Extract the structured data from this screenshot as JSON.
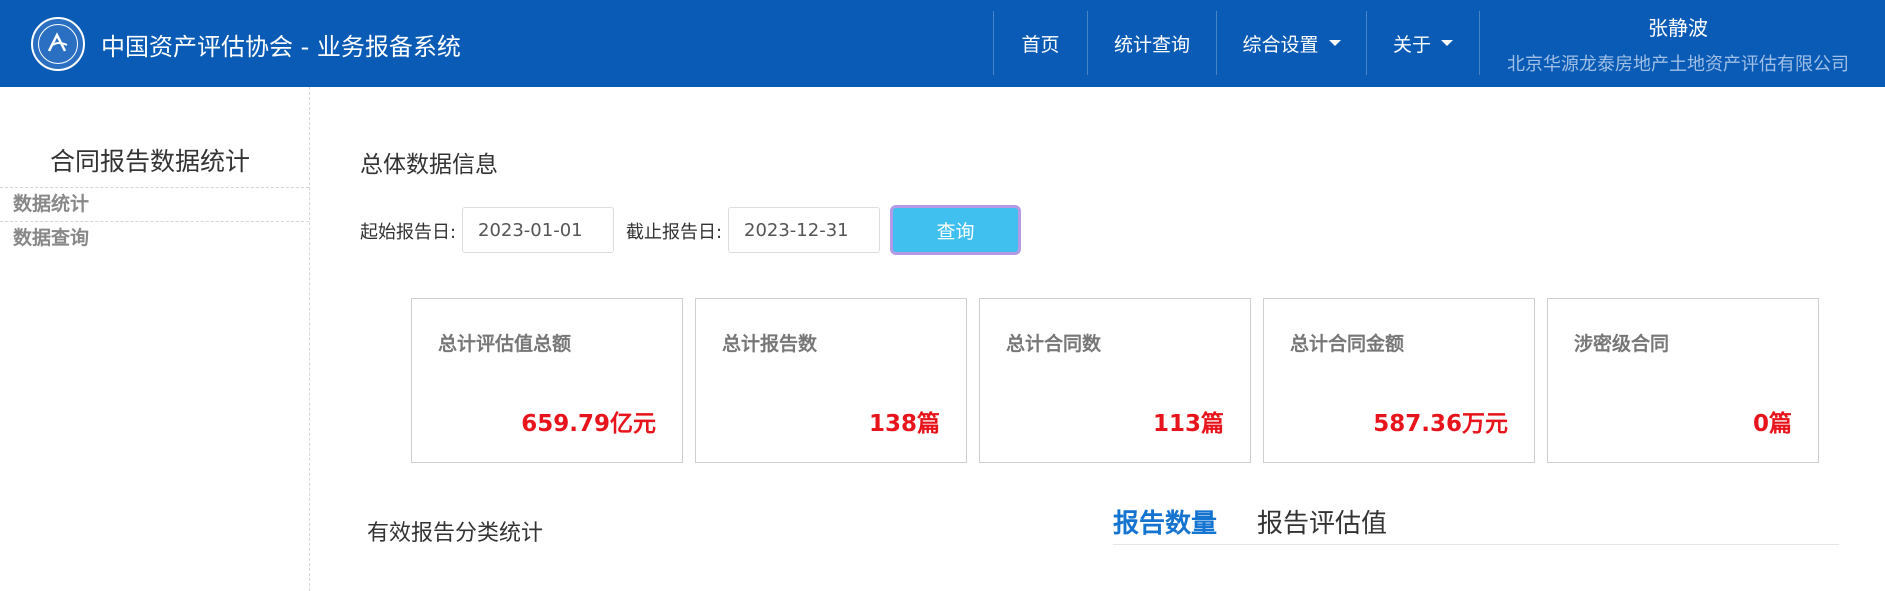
{
  "header": {
    "title": "中国资产评估协会 - 业务报备系统",
    "nav": [
      {
        "label": "首页",
        "has_dropdown": false
      },
      {
        "label": "统计查询",
        "has_dropdown": false
      },
      {
        "label": "综合设置",
        "has_dropdown": true
      },
      {
        "label": "关于",
        "has_dropdown": true
      }
    ],
    "user": {
      "name": "张静波",
      "organization": "北京华源龙泰房地产土地资产评估有限公司"
    }
  },
  "sidebar": {
    "title": "合同报告数据统计",
    "items": [
      {
        "label": "数据统计"
      },
      {
        "label": "数据查询"
      }
    ]
  },
  "main": {
    "section_title": "总体数据信息",
    "filter": {
      "start_label": "起始报告日:",
      "start_value": "2023-01-01",
      "end_label": "截止报告日:",
      "end_value": "2023-12-31",
      "query_button": "查询"
    },
    "cards": [
      {
        "label": "总计评估值总额",
        "value": "659.79亿元"
      },
      {
        "label": "总计报告数",
        "value": "138篇"
      },
      {
        "label": "总计合同数",
        "value": "113篇"
      },
      {
        "label": "总计合同金额",
        "value": "587.36万元"
      },
      {
        "label": "涉密级合同",
        "value": "0篇"
      }
    ],
    "category_title": "有效报告分类统计",
    "tabs": [
      {
        "label": "报告数量",
        "active": true
      },
      {
        "label": "报告评估值",
        "active": false
      }
    ]
  },
  "colors": {
    "header_bg": "#0a5bb5",
    "accent_blue": "#1674d1",
    "value_red": "#e8141b",
    "button_bg": "#3fc0ef"
  }
}
